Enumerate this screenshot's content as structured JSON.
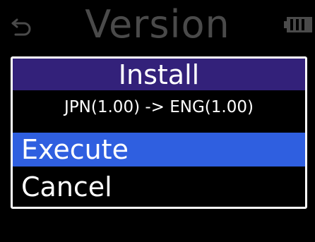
{
  "header": {
    "title": "Version",
    "back_icon": "back-arrow-icon",
    "battery_icon": "battery-icon"
  },
  "dialog": {
    "title": "Install",
    "subtitle": "JPN(1.00) -> ENG(1.00)",
    "options": [
      {
        "label": "Execute",
        "selected": true
      },
      {
        "label": "Cancel",
        "selected": false
      }
    ]
  },
  "colors": {
    "header_bg": "#33217a",
    "selection": "#2f5fe0",
    "dimmed_text": "#4a4a4a",
    "text": "#ffffff",
    "background": "#000000"
  }
}
